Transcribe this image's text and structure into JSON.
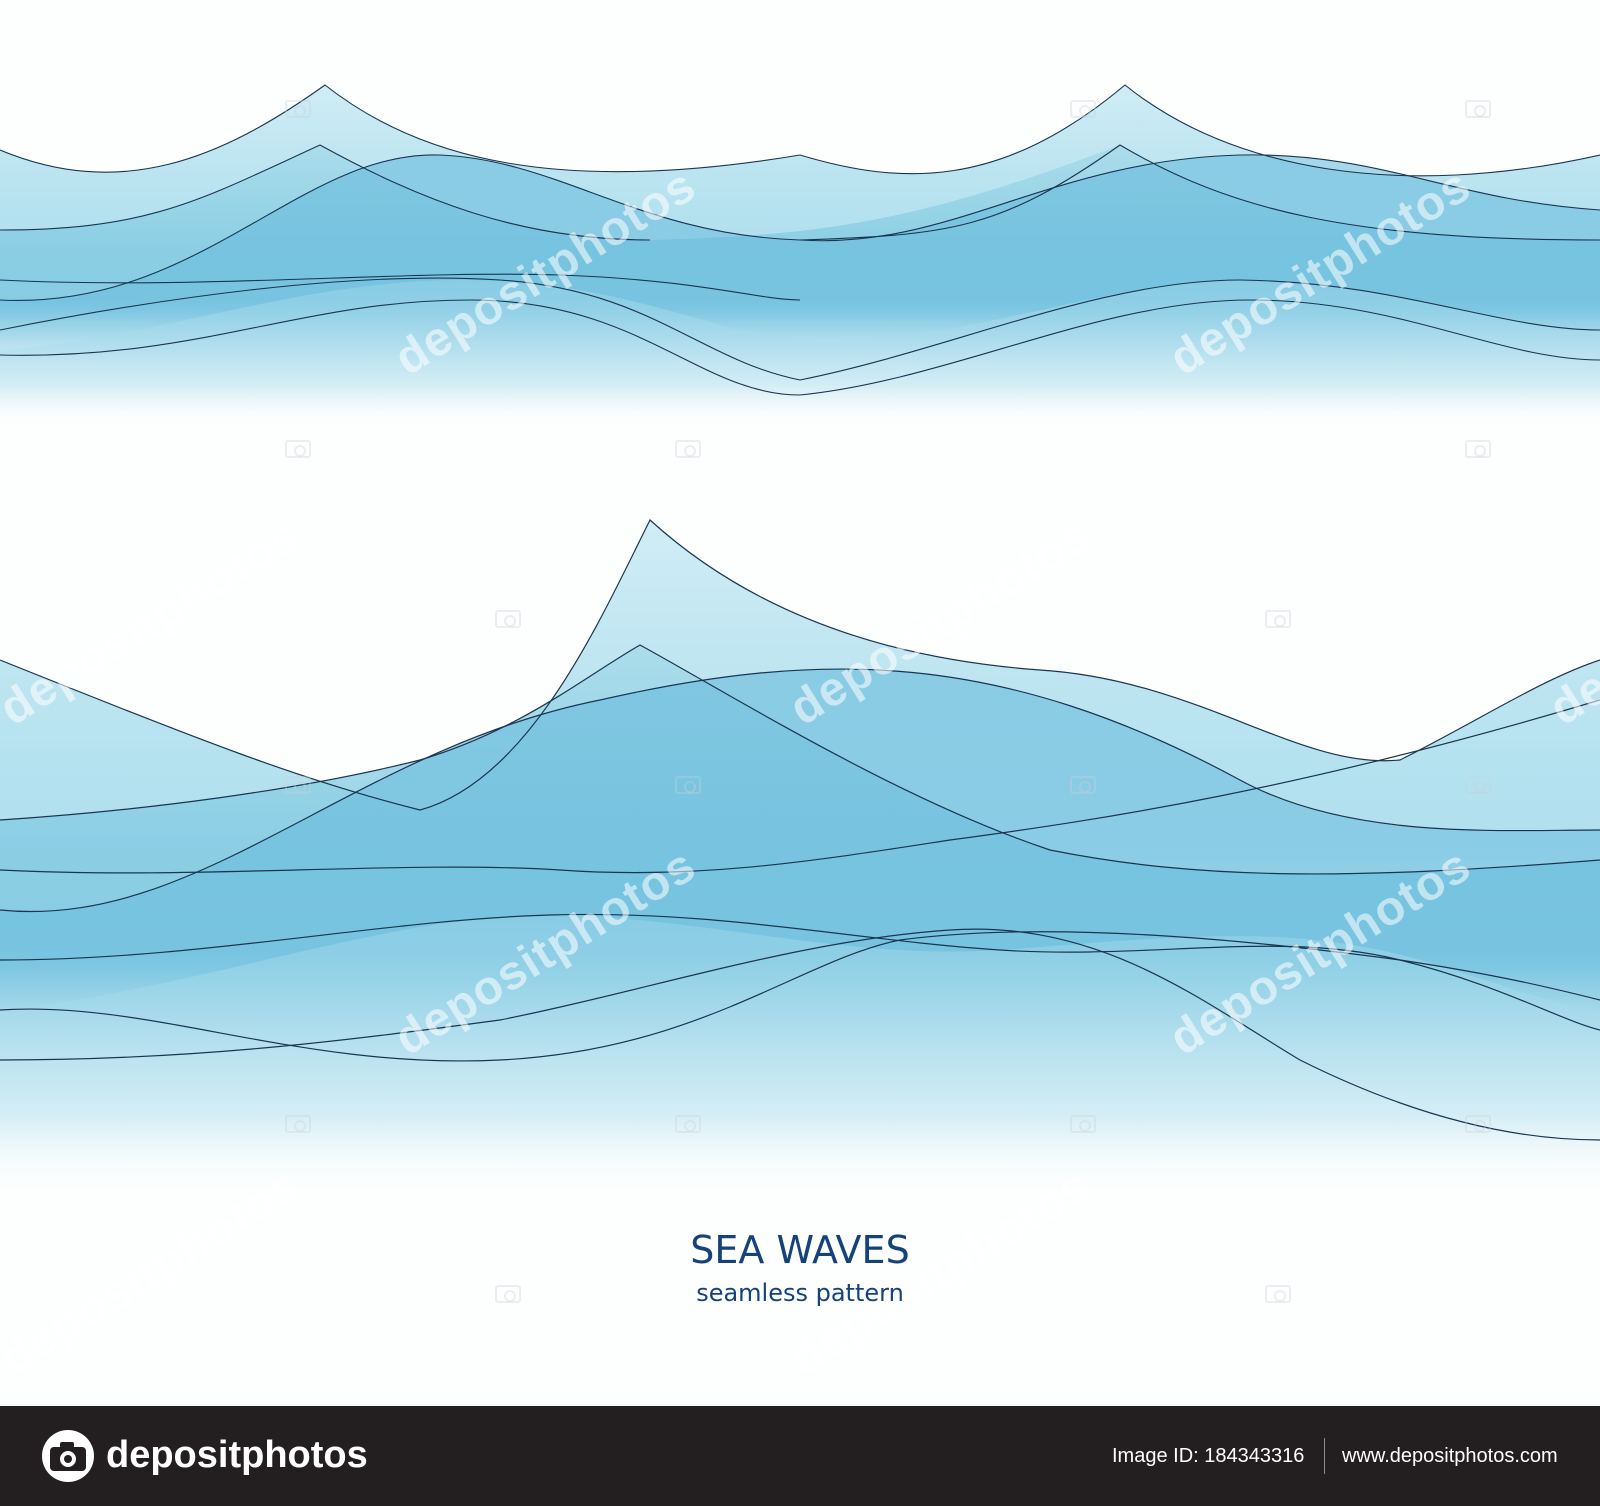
{
  "artwork": {
    "title": "SEA WAVES",
    "subtitle": "seamless pattern",
    "colors": {
      "wave_light": "#d6eef6",
      "wave_mid": "#8ccde3",
      "wave_deep": "#56b0d6",
      "line": "#1a3550",
      "text": "#16427a"
    }
  },
  "watermark": {
    "text": "depositphotos"
  },
  "footer": {
    "brand": "depositphotos",
    "image_id": "Image ID: 184343316",
    "url": "www.depositphotos.com",
    "background": "#231f20"
  }
}
